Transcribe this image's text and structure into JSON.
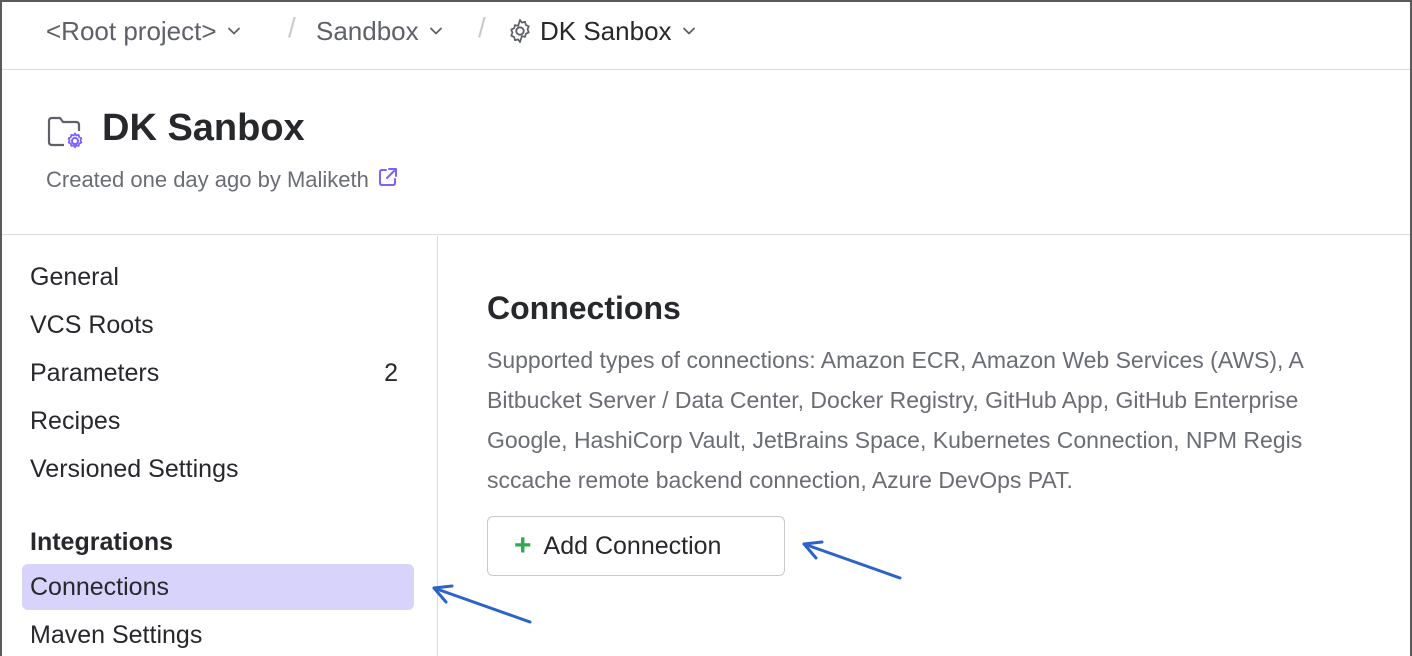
{
  "breadcrumb": {
    "items": [
      {
        "label": "<Root project>"
      },
      {
        "label": "Sandbox"
      },
      {
        "label": "DK Sanbox"
      }
    ],
    "separator": "/"
  },
  "project": {
    "title": "DK Sanbox",
    "created": "Created one day ago by Maliketh"
  },
  "sidebar": {
    "items": [
      {
        "label": "General",
        "count": ""
      },
      {
        "label": "VCS Roots",
        "count": ""
      },
      {
        "label": "Parameters",
        "count": "2"
      },
      {
        "label": "Recipes",
        "count": ""
      },
      {
        "label": "Versioned Settings",
        "count": ""
      }
    ],
    "section_title": "Integrations",
    "integration_items": [
      {
        "label": "Connections"
      },
      {
        "label": "Maven Settings"
      }
    ]
  },
  "main": {
    "title": "Connections",
    "description_lines": [
      "Supported types of connections: Amazon ECR, Amazon Web Services (AWS), A",
      "Bitbucket Server / Data Center, Docker Registry, GitHub App, GitHub Enterprise",
      "Google, HashiCorp Vault, JetBrains Space, Kubernetes Connection, NPM Regis",
      "sccache remote backend connection, Azure DevOps PAT."
    ],
    "add_button_label": "Add Connection",
    "add_button_icon": "+"
  },
  "colors": {
    "selected_bg": "#d7d3fb",
    "accent_icon": "#7b61ff",
    "plus_green": "#2fa84f",
    "annotation_arrow": "#2b63c9"
  },
  "icons": [
    "chevron-down-icon",
    "gear-icon",
    "folder-settings-icon",
    "external-link-icon",
    "plus-icon",
    "arrow-annotation"
  ]
}
